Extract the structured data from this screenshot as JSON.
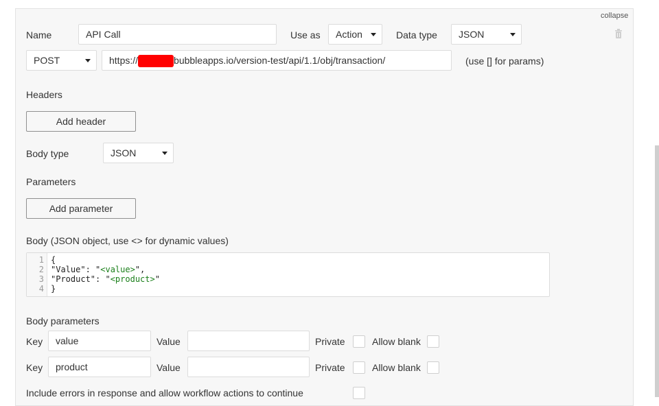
{
  "header": {
    "collapse_label": "collapse",
    "trash_icon": "trash-icon"
  },
  "call": {
    "name_label": "Name",
    "name_value": "API Call",
    "use_as_label": "Use as",
    "use_as_value": "Action",
    "data_type_label": "Data type",
    "data_type_value": "JSON"
  },
  "request": {
    "method": "POST",
    "url_prefix": "https://",
    "url_rest": "bubbleapps.io/version-test/api/1.1/obj/transaction/",
    "params_hint": "(use [] for params)"
  },
  "headers": {
    "label": "Headers",
    "add_button": "Add header"
  },
  "body_type": {
    "label": "Body type",
    "value": "JSON"
  },
  "parameters": {
    "label": "Parameters",
    "add_button": "Add parameter"
  },
  "body": {
    "label": "Body (JSON object, use <> for dynamic values)",
    "lines": [
      {
        "num": "1",
        "code": "{"
      },
      {
        "num": "2",
        "key": "\"Value\": \"",
        "dyn": "<value>",
        "tail": "\","
      },
      {
        "num": "3",
        "key": "\"Product\": \"",
        "dyn": "<product>",
        "tail": "\""
      },
      {
        "num": "4",
        "code": "}"
      }
    ]
  },
  "body_parameters": {
    "label": "Body parameters",
    "rows": [
      {
        "key_label": "Key",
        "key_value": "value",
        "value_label": "Value",
        "value_value": "",
        "private_label": "Private",
        "allow_blank_label": "Allow blank"
      },
      {
        "key_label": "Key",
        "key_value": "product",
        "value_label": "Value",
        "value_value": "",
        "private_label": "Private",
        "allow_blank_label": "Allow blank"
      }
    ]
  },
  "footer": {
    "include_errors_label": "Include errors in response and allow workflow actions to continue"
  }
}
